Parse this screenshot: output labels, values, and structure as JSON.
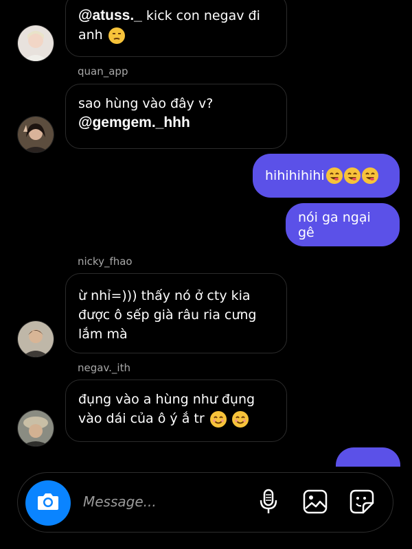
{
  "messages": [
    {
      "id": "m1",
      "direction": "incoming",
      "sender": "",
      "mention": "@atuss._",
      "text_after_mention": "kick con negav đi anh",
      "emoji": [
        "unamused-face"
      ]
    },
    {
      "id": "m2",
      "direction": "incoming",
      "sender": "quan_app",
      "text": "sao hùng vào đây v?",
      "mention": "@gemgem._hhh"
    },
    {
      "id": "m3",
      "direction": "outgoing",
      "text": "hihihihihi",
      "emoji": [
        "yum-face",
        "yum-face",
        "yum-face"
      ]
    },
    {
      "id": "m4",
      "direction": "outgoing",
      "text": "nói ga ngại gê"
    },
    {
      "id": "m5",
      "direction": "incoming",
      "sender": "nicky_fhao",
      "text": "ừ nhỉ=))) thấy nó ở cty kia được ô sếp già râu ria cưng lắm mà"
    },
    {
      "id": "m6",
      "direction": "incoming",
      "sender": "negav._ith",
      "text": "đụng vào a hùng như đụng vào dái của ô ý ắ tr",
      "emoji": [
        "smiling-face",
        "smiling-face"
      ]
    }
  ],
  "composer": {
    "placeholder": "Message...",
    "icons": [
      "camera-icon",
      "microphone-icon",
      "gallery-icon",
      "sticker-icon"
    ]
  },
  "colors": {
    "background": "#000000",
    "outgoing_bubble": "#5b51e8",
    "camera_button": "#0a84ff",
    "secondary_text": "#a8a8a8"
  }
}
